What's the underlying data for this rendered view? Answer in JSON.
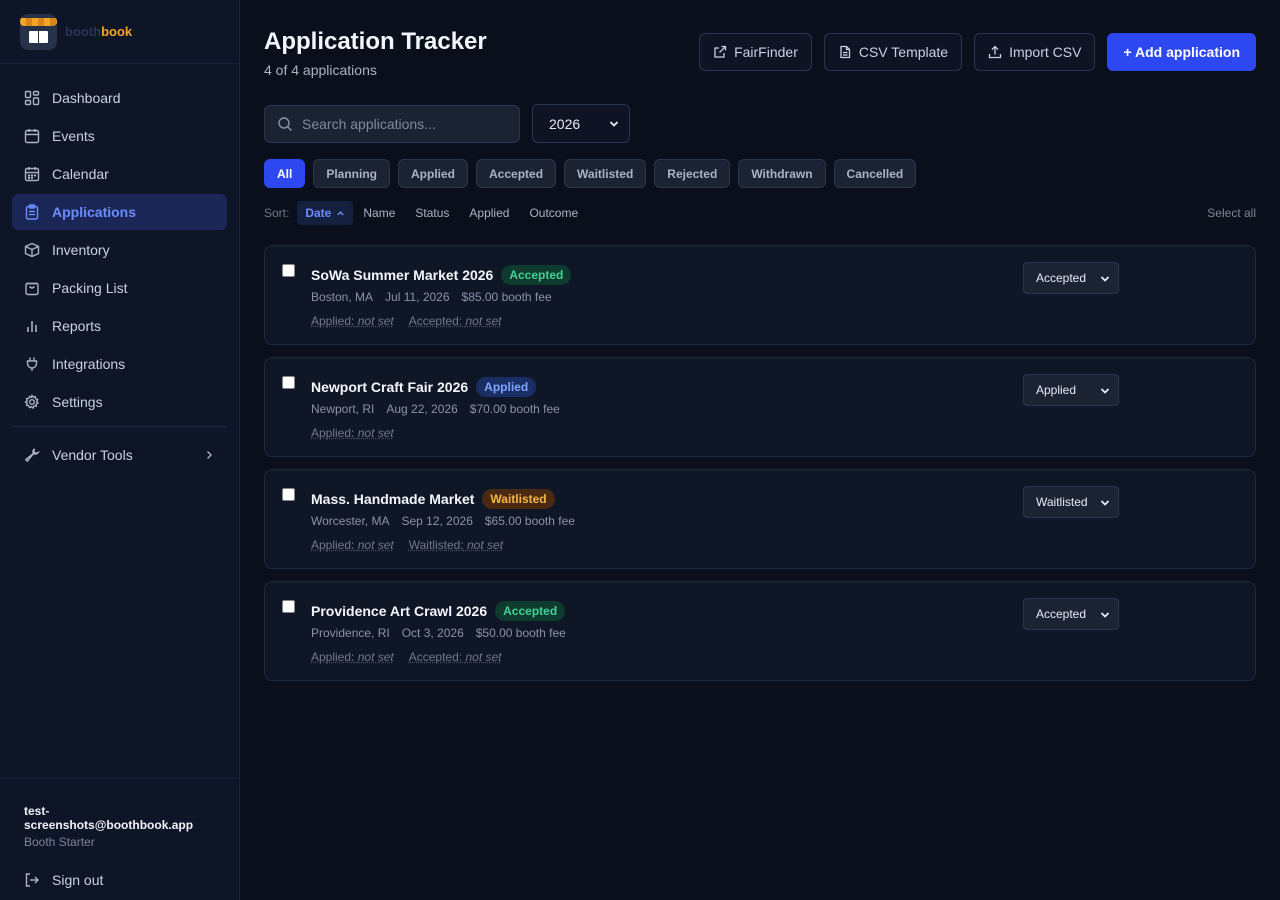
{
  "brand": {
    "logo_text_part1": "booth",
    "logo_text_part2": "book"
  },
  "sidebar": {
    "items": [
      {
        "label": "Dashboard",
        "icon": "grid-icon"
      },
      {
        "label": "Events",
        "icon": "calendar-icon"
      },
      {
        "label": "Calendar",
        "icon": "calendar-grid-icon"
      },
      {
        "label": "Applications",
        "icon": "clipboard-icon",
        "active": true
      },
      {
        "label": "Inventory",
        "icon": "box-icon"
      },
      {
        "label": "Packing List",
        "icon": "bag-icon"
      },
      {
        "label": "Reports",
        "icon": "bar-chart-icon"
      },
      {
        "label": "Integrations",
        "icon": "plug-icon"
      },
      {
        "label": "Settings",
        "icon": "gear-icon"
      }
    ],
    "vendor_tools": {
      "label": "Vendor Tools",
      "icon": "wrench-icon"
    },
    "user": {
      "email": "test-screenshots@boothbook.app",
      "plan": "Booth Starter"
    },
    "signout": {
      "label": "Sign out",
      "icon": "logout-icon"
    }
  },
  "header": {
    "title": "Application Tracker",
    "subtitle": "4 of 4 applications",
    "actions": {
      "fairfinder": "FairFinder",
      "csv_template": "CSV Template",
      "import_csv": "Import CSV",
      "add": "+ Add application"
    }
  },
  "search": {
    "placeholder": "Search applications..."
  },
  "year_filter": {
    "selected": "2026"
  },
  "filters": [
    "All",
    "Planning",
    "Applied",
    "Accepted",
    "Waitlisted",
    "Rejected",
    "Withdrawn",
    "Cancelled"
  ],
  "active_filter": "All",
  "sort": {
    "label": "Sort:",
    "options": [
      "Date",
      "Name",
      "Status",
      "Applied",
      "Outcome"
    ],
    "active": "Date",
    "direction": "ascending",
    "select_all": "Select all"
  },
  "applications": [
    {
      "name": "SoWa Summer Market 2026",
      "badge": "Accepted",
      "location": "Boston, MA",
      "date": "Jul 11, 2026",
      "fee": "$85.00 booth fee",
      "applied_label": "Applied:",
      "applied_value": "not set",
      "outcome_label": "Accepted:",
      "outcome_value": "not set",
      "status": "Accepted"
    },
    {
      "name": "Newport Craft Fair 2026",
      "badge": "Applied",
      "location": "Newport, RI",
      "date": "Aug 22, 2026",
      "fee": "$70.00 booth fee",
      "applied_label": "Applied:",
      "applied_value": "not set",
      "status": "Applied"
    },
    {
      "name": "Mass. Handmade Market",
      "badge": "Waitlisted",
      "location": "Worcester, MA",
      "date": "Sep 12, 2026",
      "fee": "$65.00 booth fee",
      "applied_label": "Applied:",
      "applied_value": "not set",
      "outcome_label": "Waitlisted:",
      "outcome_value": "not set",
      "status": "Waitlisted"
    },
    {
      "name": "Providence Art Crawl 2026",
      "badge": "Accepted",
      "location": "Providence, RI",
      "date": "Oct 3, 2026",
      "fee": "$50.00 booth fee",
      "applied_label": "Applied:",
      "applied_value": "not set",
      "outcome_label": "Accepted:",
      "outcome_value": "not set",
      "status": "Accepted"
    }
  ]
}
